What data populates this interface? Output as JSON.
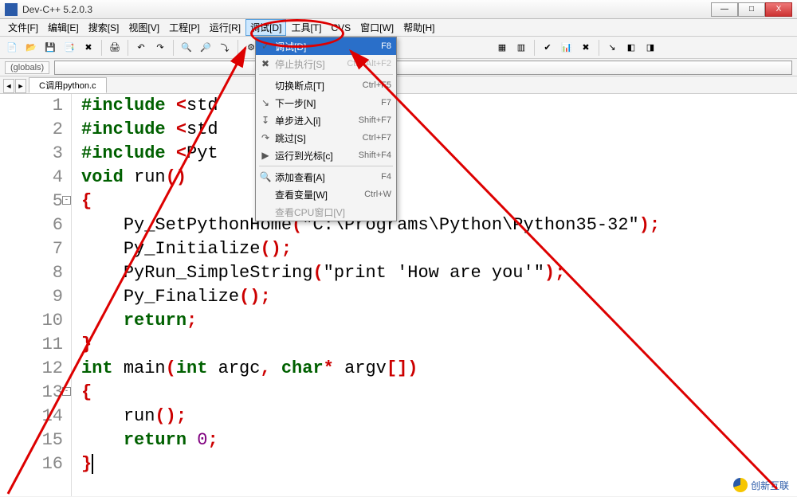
{
  "window": {
    "title": "Dev-C++ 5.2.0.3",
    "buttons": {
      "min": "—",
      "max": "□",
      "close": "X"
    }
  },
  "menu": [
    "文件[F]",
    "编辑[E]",
    "搜索[S]",
    "视图[V]",
    "工程[P]",
    "运行[R]",
    "调试[D]",
    "工具[T]",
    "CVS",
    "窗口[W]",
    "帮助[H]"
  ],
  "menu_highlight_index": 6,
  "globals": {
    "label": "(globals)"
  },
  "tab": {
    "name": "C调用python.c"
  },
  "dropdown": {
    "items": [
      {
        "icon": "✓",
        "label": "调试[D]",
        "shortcut": "F8",
        "highlighted": true
      },
      {
        "icon": "✖",
        "label": "停止执行[S]",
        "shortcut": "Ctrl+Alt+F2",
        "disabled": true
      },
      {
        "sep": true
      },
      {
        "icon": "",
        "label": "切换断点[T]",
        "shortcut": "Ctrl+F5"
      },
      {
        "icon": "↘",
        "label": "下一步[N]",
        "shortcut": "F7"
      },
      {
        "icon": "↧",
        "label": "单步进入[i]",
        "shortcut": "Shift+F7"
      },
      {
        "icon": "↷",
        "label": "跳过[S]",
        "shortcut": "Ctrl+F7"
      },
      {
        "icon": "▶",
        "label": "运行到光标[c]",
        "shortcut": "Shift+F4"
      },
      {
        "sep": true
      },
      {
        "icon": "🔍",
        "label": "添加查看[A]",
        "shortcut": "F4"
      },
      {
        "icon": "",
        "label": "查看变量[W]",
        "shortcut": "Ctrl+W"
      },
      {
        "icon": "",
        "label": "查看CPU窗口[V]",
        "shortcut": "",
        "disabled": true
      }
    ]
  },
  "code": {
    "lines": [
      {
        "n": 1,
        "html": "<span class='pp'>#include</span> <span class='punc'>&lt;</span><span class='id'>std</span>"
      },
      {
        "n": 2,
        "html": "<span class='pp'>#include</span> <span class='punc'>&lt;</span><span class='id'>std</span>"
      },
      {
        "n": 3,
        "html": "<span class='pp'>#include</span> <span class='punc'>&lt;</span><span class='id'>Pyt</span>"
      },
      {
        "n": 4,
        "html": "<span class='kw'>void</span> <span class='func'>run</span><span class='punc'>()</span>"
      },
      {
        "n": 5,
        "fold": true,
        "html": "<span class='punc'>{</span>"
      },
      {
        "n": 6,
        "html": "    <span class='func'>Py_SetPythonHome</span><span class='punc'>(</span><span class='str'>\"C:\\Programs\\Python\\Python35-32\"</span><span class='punc'>);</span>"
      },
      {
        "n": 7,
        "html": "    <span class='func'>Py_Initialize</span><span class='punc'>();</span>"
      },
      {
        "n": 8,
        "html": "    <span class='func'>PyRun_SimpleString</span><span class='punc'>(</span><span class='str'>\"print 'How are you'\"</span><span class='punc'>);</span>"
      },
      {
        "n": 9,
        "html": "    <span class='func'>Py_Finalize</span><span class='punc'>();</span>"
      },
      {
        "n": 10,
        "html": "    <span class='kw'>return</span><span class='punc'>;</span>"
      },
      {
        "n": 11,
        "html": "<span class='punc'>}</span>"
      },
      {
        "n": 12,
        "html": "<span class='kw'>int</span> <span class='func'>main</span><span class='punc'>(</span><span class='kw'>int</span> <span class='id'>argc</span><span class='punc'>,</span> <span class='kw'>char</span><span class='star'>*</span> <span class='id'>argv</span><span class='punc'>[])</span>"
      },
      {
        "n": 13,
        "fold": true,
        "html": "<span class='punc'>{</span>"
      },
      {
        "n": 14,
        "html": "    <span class='func'>run</span><span class='punc'>();</span>"
      },
      {
        "n": 15,
        "html": "    <span class='kw'>return</span> <span class='num'>0</span><span class='punc'>;</span>"
      },
      {
        "n": 16,
        "html": "<span class='punc'>}</span><span style='border-left:2px solid #000;'>&nbsp;</span>"
      }
    ]
  },
  "watermark": {
    "text": "创新互联"
  }
}
